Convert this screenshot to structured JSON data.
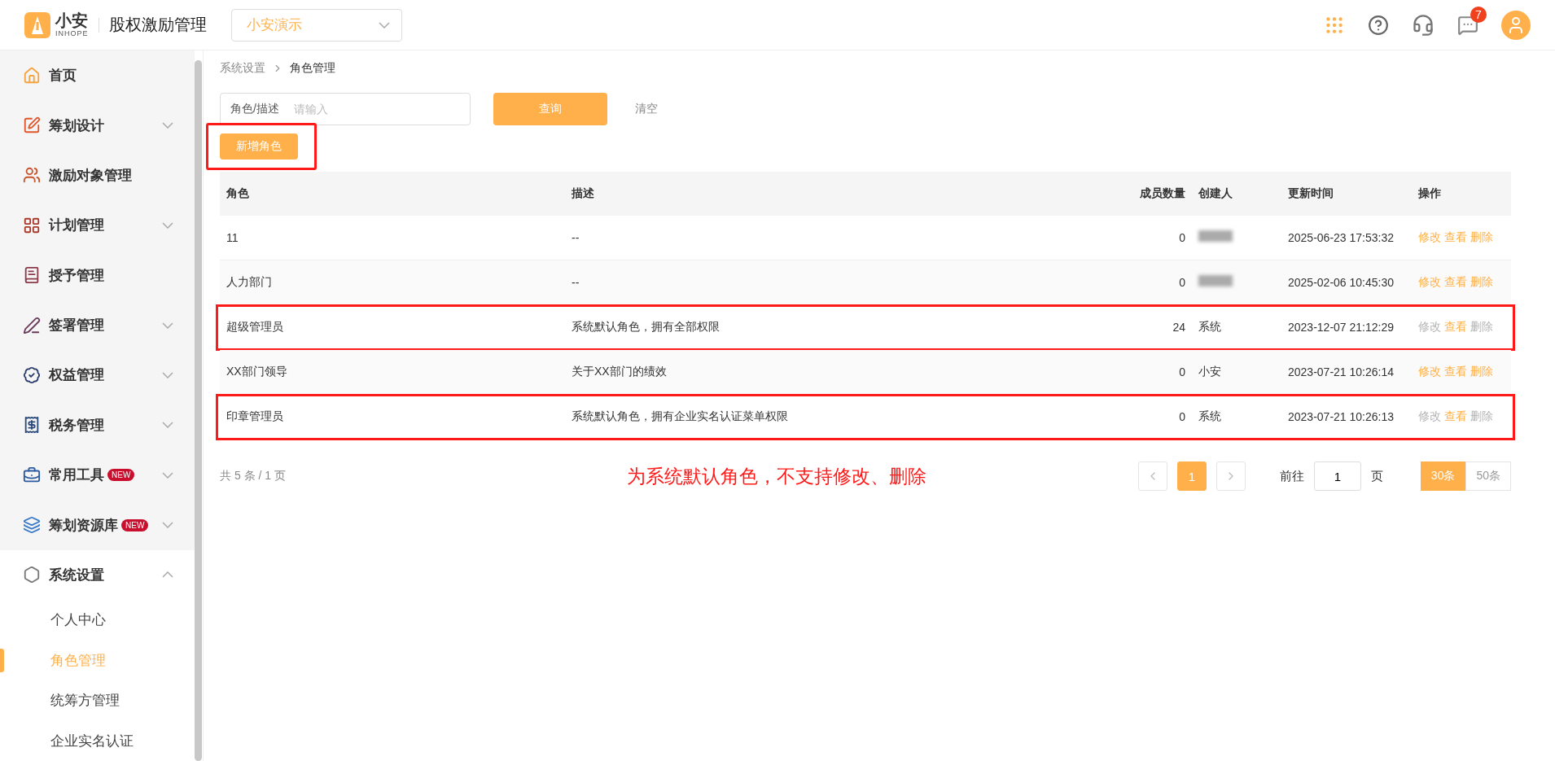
{
  "header": {
    "logo_text": "小安",
    "logo_subtext": "INHOPE",
    "app_title": "股权激励管理",
    "company_select": "小安演示",
    "message_badge": "7"
  },
  "sidebar": {
    "items": [
      {
        "label": "首页",
        "expandable": false
      },
      {
        "label": "筹划设计",
        "expandable": true,
        "expanded": false
      },
      {
        "label": "激励对象管理",
        "expandable": false
      },
      {
        "label": "计划管理",
        "expandable": true,
        "expanded": false
      },
      {
        "label": "授予管理",
        "expandable": false
      },
      {
        "label": "签署管理",
        "expandable": true,
        "expanded": false
      },
      {
        "label": "权益管理",
        "expandable": true,
        "expanded": false
      },
      {
        "label": "税务管理",
        "expandable": true,
        "expanded": false
      },
      {
        "label": "常用工具",
        "badge": "NEW",
        "expandable": true,
        "expanded": false
      },
      {
        "label": "筹划资源库",
        "badge": "NEW",
        "expandable": true,
        "expanded": false
      },
      {
        "label": "系统设置",
        "expandable": true,
        "expanded": true,
        "children": [
          {
            "label": "个人中心",
            "selected": false
          },
          {
            "label": "角色管理",
            "selected": true
          },
          {
            "label": "统筹方管理",
            "selected": false
          },
          {
            "label": "企业实名认证",
            "selected": false
          }
        ]
      }
    ]
  },
  "breadcrumb": [
    "系统设置",
    "角色管理"
  ],
  "search": {
    "label": "角色/描述",
    "placeholder": "请输入"
  },
  "buttons": {
    "query": "查询",
    "clear": "清空",
    "add": "新增角色"
  },
  "add_highlighted": true,
  "table": {
    "columns": [
      "角色",
      "描述",
      "成员数量",
      "创建人",
      "更新时间",
      "操作"
    ],
    "rows": [
      {
        "role": "11",
        "description": "--",
        "members": "0",
        "creator_blurred": true,
        "updated": "2025-06-23 17:53:32",
        "highlighted": false,
        "actions": [
          {
            "label": "修改",
            "disabled": false
          },
          {
            "label": "查看",
            "disabled": false
          },
          {
            "label": "删除",
            "disabled": false
          }
        ]
      },
      {
        "role": "人力部门",
        "description": "--",
        "members": "0",
        "creator_blurred": true,
        "updated": "2025-02-06 10:45:30",
        "highlighted": false,
        "actions": [
          {
            "label": "修改",
            "disabled": false
          },
          {
            "label": "查看",
            "disabled": false
          },
          {
            "label": "删除",
            "disabled": false
          }
        ]
      },
      {
        "role": "超级管理员",
        "description": "系统默认角色，拥有全部权限",
        "members": "24",
        "creator": "系统",
        "creator_blurred": false,
        "updated": "2023-12-07 21:12:29",
        "highlighted": true,
        "actions": [
          {
            "label": "修改",
            "disabled": true
          },
          {
            "label": "查看",
            "disabled": false
          },
          {
            "label": "删除",
            "disabled": true
          }
        ]
      },
      {
        "role": "XX部门领导",
        "description": "关于XX部门的绩效",
        "members": "0",
        "creator": "小安",
        "creator_blurred": false,
        "updated": "2023-07-21 10:26:14",
        "highlighted": false,
        "actions": [
          {
            "label": "修改",
            "disabled": false
          },
          {
            "label": "查看",
            "disabled": false
          },
          {
            "label": "删除",
            "disabled": false
          }
        ]
      },
      {
        "role": "印章管理员",
        "description": "系统默认角色，拥有企业实名认证菜单权限",
        "members": "0",
        "creator": "系统",
        "creator_blurred": false,
        "updated": "2023-07-21 10:26:13",
        "highlighted": true,
        "actions": [
          {
            "label": "修改",
            "disabled": true
          },
          {
            "label": "查看",
            "disabled": false
          },
          {
            "label": "删除",
            "disabled": true
          }
        ]
      }
    ]
  },
  "footer": {
    "summary": "共 5 条 / 1 页",
    "annotation": "为系统默认角色，不支持修改、删除",
    "pages": [
      {
        "label": "1",
        "selected": true
      }
    ],
    "goto_label": "前往",
    "goto_value": "1",
    "goto_suffix": "页",
    "sizes": [
      {
        "label": "30条",
        "selected": true
      },
      {
        "label": "50条",
        "selected": false
      }
    ]
  }
}
